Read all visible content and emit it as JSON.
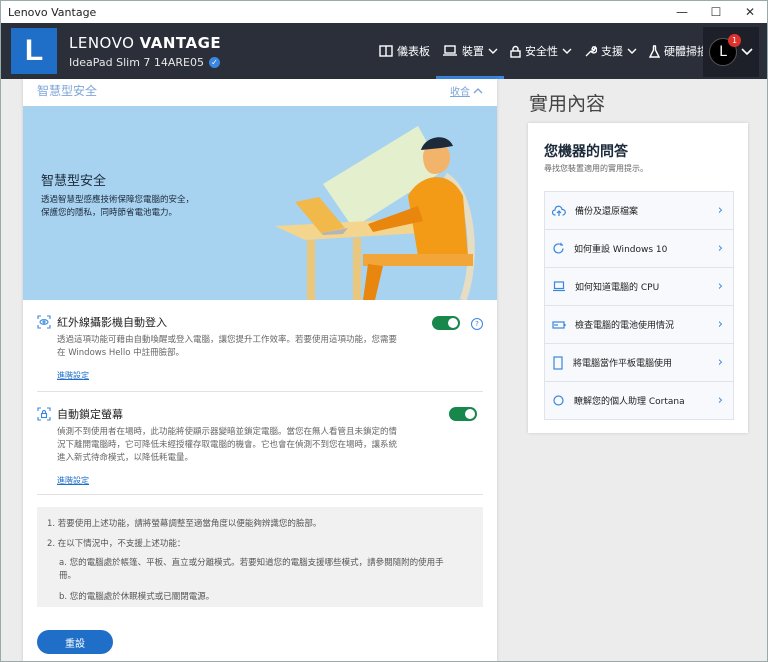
{
  "window": {
    "title": "Lenovo Vantage",
    "minimize": "—",
    "maximize": "☐",
    "close": "✕"
  },
  "header": {
    "logo_letter": "L",
    "brand_light": "LENOVO ",
    "brand_bold": "VANTAGE",
    "model": "IdeaPad Slim 7 14ARE05",
    "nav": [
      {
        "label": "儀表板",
        "icon": "dashboard-icon"
      },
      {
        "label": "裝置",
        "icon": "laptop-icon"
      },
      {
        "label": "安全性",
        "icon": "lock-icon"
      },
      {
        "label": "支援",
        "icon": "wrench-icon"
      },
      {
        "label": "硬體掃描",
        "icon": "flask-icon"
      }
    ],
    "user_initial": "L",
    "notification_count": "1"
  },
  "left": {
    "section_title": "智慧型安全",
    "collapse_label": "收合",
    "hero_title": "智慧型安全",
    "hero_desc": "透過智慧型感應技術保障您電腦的安全，保護您的隱私，同時節省電池電力。",
    "items": [
      {
        "title": "紅外線攝影機自動登入",
        "desc": "透過這項功能可藉由自動喚醒或登入電腦，讓您提升工作效率。若要使用這項功能，您需要在 Windows Hello 中註冊臉部。",
        "link": "進階設定",
        "enabled": true
      },
      {
        "title": "自動鎖定螢幕",
        "desc": "偵測不到使用者在場時，此功能將使顯示器變暗並鎖定電腦。當您在無人看管且未鎖定的情況下離開電腦時，它可降低未經授權存取電腦的機會。它也會在偵測不到您在場時，讓系統進入新式待命模式，以降低耗電量。",
        "link": "進階設定",
        "enabled": true
      }
    ],
    "notes": {
      "n1": "1. 若要使用上述功能，請將螢幕調整至適當角度以便能夠辨識您的臉部。",
      "n2": "2. 在以下情況中，不支援上述功能：",
      "na": "a. 您的電腦處於帳篷、平板、直立或分離模式。若要知道您的電腦支援哪些模式，請參閱隨附的使用手冊。",
      "nb": "b. 您的電腦處於休眠模式或已關閉電源。"
    },
    "reset_label": "重設"
  },
  "right": {
    "title": "實用內容",
    "card_title": "您機器的問答",
    "card_subtitle": "尋找您裝置適用的實用提示。",
    "tips": [
      {
        "label": "備份及還原檔案",
        "icon": "cloud-upload-icon"
      },
      {
        "label": "如何重設 Windows 10",
        "icon": "refresh-icon"
      },
      {
        "label": "如何知道電腦的 CPU",
        "icon": "laptop-icon"
      },
      {
        "label": "檢查電腦的電池使用情況",
        "icon": "battery-icon"
      },
      {
        "label": "將電腦當作平板電腦使用",
        "icon": "tablet-icon"
      },
      {
        "label": "瞭解您的個人助理 Cortana",
        "icon": "circle-icon"
      }
    ]
  }
}
